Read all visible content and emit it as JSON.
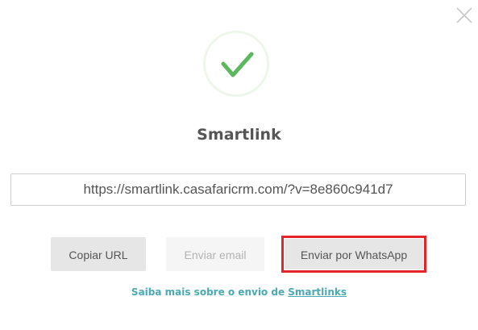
{
  "modal": {
    "title": "Smartlink",
    "close_icon": "close-icon",
    "success_icon": "checkmark-icon",
    "accent_color": "#5cb85c",
    "url_value": "https://smartlink.casafaricrm.com/?v=8e860c941d7"
  },
  "actions": {
    "copy_label": "Copiar URL",
    "email_label": "Enviar email",
    "email_disabled": true,
    "whatsapp_label": "Enviar por WhatsApp",
    "highlight_color": "#e3242b"
  },
  "footer": {
    "text": "Saiba mais sobre o envio de ",
    "link_label": "Smartlinks"
  }
}
